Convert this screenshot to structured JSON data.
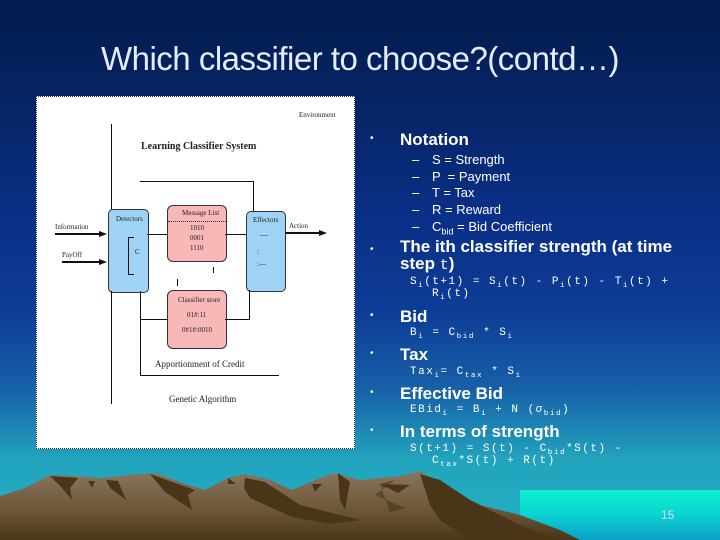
{
  "slide": {
    "title": "Which classifier to choose?(contd…)",
    "page_number": "15"
  },
  "diagram": {
    "environment_label": "Environment",
    "system_label": "Learning Classifier System",
    "detectors_label": "Detectors",
    "detectors_content": "C",
    "message_list_label": "Message List",
    "message_list_items": [
      "1010",
      "0001",
      "1110"
    ],
    "effectors_label": "Effectors",
    "classifier_store_label": "Classifier store",
    "classifier_store_items": [
      "01#:11",
      "0#1#:0010"
    ],
    "information_label": "Information",
    "payoff_label": "PayOff",
    "action_label": "Action",
    "credit_label": "Apportionment of Credit",
    "ga_label": "Genetic Algorithm"
  },
  "notes": {
    "notation": {
      "label": "Notation",
      "items": [
        {
          "symbol": "S",
          "text": " = Strength"
        },
        {
          "symbol": "P",
          "text": "  = Payment"
        },
        {
          "symbol": "T",
          "text": " = Tax"
        },
        {
          "symbol": "R",
          "text": " = Reward"
        },
        {
          "symbol": "C",
          "symbol_sub": "bid",
          "text": " = Bid Coefficient"
        }
      ]
    },
    "strength": {
      "label": "The ith classifier strength (at time step",
      "label_var": "t",
      "label_end": ")",
      "formula_line1": "S<sub>i</sub>(t+1) = S<sub>i</sub>(t) - P<sub>i</sub>(t) - T<sub>i</sub>(t) +",
      "formula_line2": "R<sub>i</sub>(t)"
    },
    "bid": {
      "label": "Bid",
      "formula": "B<sub>i</sub> = C<sub>bid</sub> * S<sub>i</sub>"
    },
    "tax": {
      "label": "Tax",
      "formula": "Tax<sub>i</sub>= C<sub>tax</sub> * S<sub>i</sub>"
    },
    "effective_bid": {
      "label": "Effective Bid",
      "formula": "EBid<sub>i</sub> = B<sub>i</sub> + N (σ<sub>bid</sub>)"
    },
    "in_terms": {
      "label": "In terms of strength",
      "formula_line1": "S(t+1) = S(t) - C<sub>bid</sub>*S(t) -",
      "formula_line2": "C<sub>tax</sub>*S(t) + R(t)"
    }
  },
  "bullet_glyph": "•",
  "dash_glyph": "–"
}
